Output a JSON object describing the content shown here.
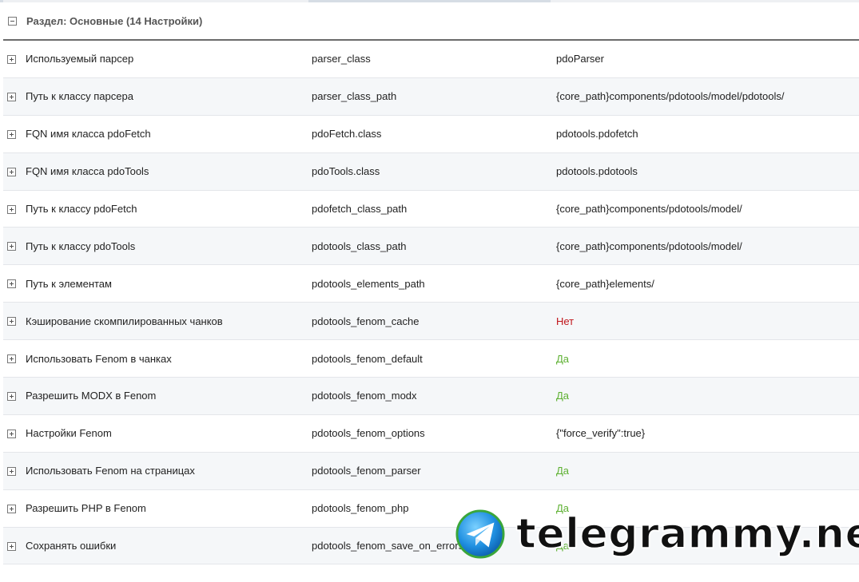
{
  "group": {
    "title": "Раздел: Основные (14 Настройки)"
  },
  "rows": [
    {
      "name": "Используемый парсер",
      "key": "parser_class",
      "value": "pdoParser",
      "type": "text"
    },
    {
      "name": "Путь к классу парсера",
      "key": "parser_class_path",
      "value": "{core_path}components/pdotools/model/pdotools/",
      "type": "text"
    },
    {
      "name": "FQN имя класса pdoFetch",
      "key": "pdoFetch.class",
      "value": "pdotools.pdofetch",
      "type": "text"
    },
    {
      "name": "FQN имя класса pdoTools",
      "key": "pdoTools.class",
      "value": "pdotools.pdotools",
      "type": "text"
    },
    {
      "name": "Путь к классу pdoFetch",
      "key": "pdofetch_class_path",
      "value": "{core_path}components/pdotools/model/",
      "type": "text"
    },
    {
      "name": "Путь к классу pdoTools",
      "key": "pdotools_class_path",
      "value": "{core_path}components/pdotools/model/",
      "type": "text"
    },
    {
      "name": "Путь к элементам",
      "key": "pdotools_elements_path",
      "value": "{core_path}elements/",
      "type": "text"
    },
    {
      "name": "Кэширование скомпилированных чанков",
      "key": "pdotools_fenom_cache",
      "value": "Нет",
      "type": "no"
    },
    {
      "name": "Использовать Fenom в чанках",
      "key": "pdotools_fenom_default",
      "value": "Да",
      "type": "yes"
    },
    {
      "name": "Разрешить MODX в Fenom",
      "key": "pdotools_fenom_modx",
      "value": "Да",
      "type": "yes"
    },
    {
      "name": "Настройки Fenom",
      "key": "pdotools_fenom_options",
      "value": "{\"force_verify\":true}",
      "type": "text"
    },
    {
      "name": "Использовать Fenom на страницах",
      "key": "pdotools_fenom_parser",
      "value": "Да",
      "type": "yes"
    },
    {
      "name": "Разрешить PHP в Fenom",
      "key": "pdotools_fenom_php",
      "value": "Да",
      "type": "yes"
    },
    {
      "name": "Сохранять ошибки",
      "key": "pdotools_fenom_save_on_errors",
      "value": "Да",
      "type": "yes"
    }
  ],
  "colors": {
    "yes": "#5cb030",
    "no": "#c0151b"
  },
  "icons": {
    "collapse": "minus-square-icon",
    "expand": "plus-square-icon",
    "watermark_logo": "telegram-paper-plane-icon"
  },
  "watermark": {
    "text": "telegrammy.net"
  }
}
